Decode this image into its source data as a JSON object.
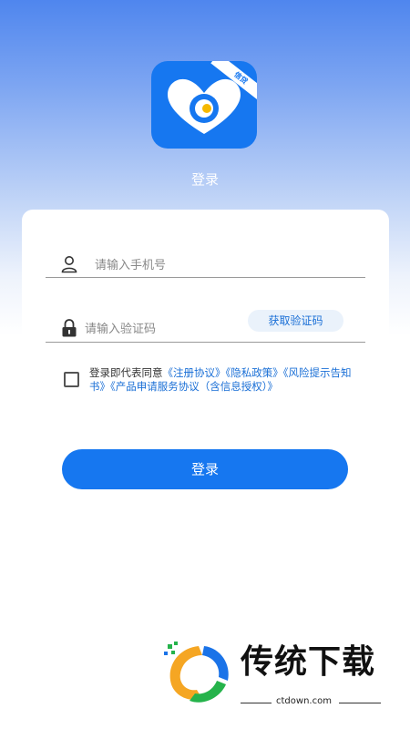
{
  "app_icon": {
    "badge": "信贷",
    "icon": "heart-logo-icon"
  },
  "page": {
    "title": "登录"
  },
  "phone": {
    "placeholder": "请输入手机号",
    "icon": "user-icon"
  },
  "code": {
    "placeholder": "请输入验证码",
    "icon": "lock-icon",
    "send_label": "获取验证码"
  },
  "agreement": {
    "checked": false,
    "prefix": "登录即代表同意",
    "links": [
      "《注册协议》",
      "《隐私政策》",
      "《风险提示告知书》",
      "《产品申请服务协议（含信息授权）》"
    ]
  },
  "login": {
    "label": "登录"
  },
  "watermark": {
    "title": "传统下载",
    "domain": "ctdown.com"
  },
  "colors": {
    "primary": "#1677f0",
    "link": "#1a6fd6"
  }
}
